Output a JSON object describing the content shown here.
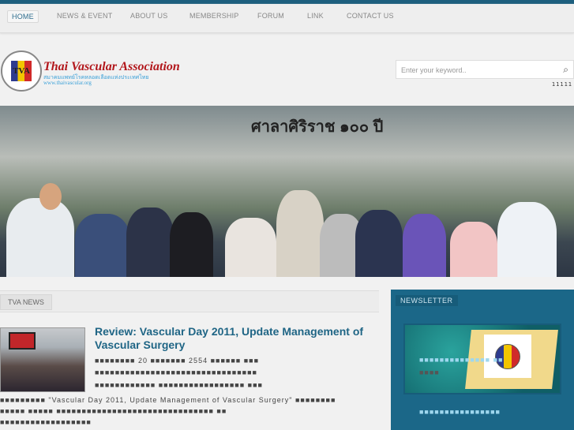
{
  "nav": {
    "items": [
      {
        "label": "HOME",
        "active": true
      },
      {
        "label": "NEWS & EVENT"
      },
      {
        "label": "ABOUT US"
      },
      {
        "label": "MEMBERSHIP"
      },
      {
        "label": "FORUM"
      },
      {
        "label": "LINK"
      },
      {
        "label": "CONTACT US"
      }
    ]
  },
  "header": {
    "logo_text": "TVA",
    "brand_name": "Thai Vascular Association",
    "brand_thai": "สมาคมแพทย์โรคหลอดเลือดแห่งประเทศไทย",
    "brand_url": "www.thaivascular.org"
  },
  "search": {
    "placeholder": "Enter your keyword..",
    "counter": "11111"
  },
  "banner": {
    "sign": "ศาลาศิริราช ๑๐๐ ปี"
  },
  "news": {
    "tab": "TVA NEWS",
    "title": "Review: Vascular Day 2011, Update Management of Vascular Surgery",
    "lines": [
      "■■■■■■■■ 20 ■■■■■■■ 2554 ■■■■■■ ■■■",
      "■■■■■■■■■■■■■■■■■■■■■■■■■■■■■■■■",
      "■■■■■■■■■■■■ ■■■■■■■■■■■■■■■■■ ■■■",
      "■■■■■■■■■ \"Vascular Day 2011, Update Management of Vascular Surgery\" ■■■■■■■■",
      "■■■■■ ■■■■■ ■■■■■■■■■■■■■■■■■■■■■■■■■■■■■■■ ■■",
      "■■■■■■■■■■■■■■■■■■"
    ]
  },
  "sidebar": {
    "tab": "NEWSLETTER",
    "lines": [
      "■■■■■■■■■■■■■■   ■■",
      "■■■■",
      "■■■■■■■■■■■■■■■■"
    ]
  }
}
